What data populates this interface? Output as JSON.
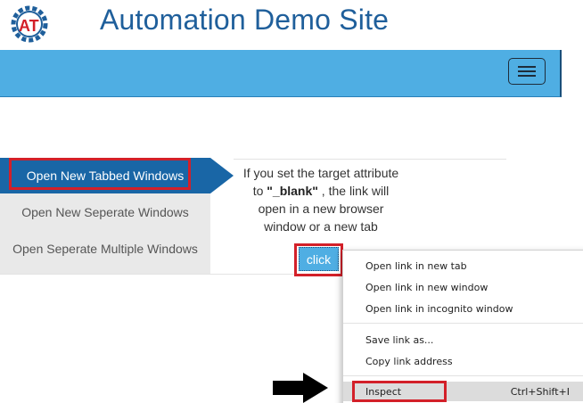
{
  "header": {
    "title": "Automation Demo Site",
    "logo_letters": "AT",
    "brand_color": "#1f5f9b"
  },
  "navbar": {
    "color": "#4faee3",
    "menu_icon": "hamburger-menu-icon"
  },
  "tabs": [
    {
      "label": "Open New Tabbed Windows",
      "active": true
    },
    {
      "label": "Open New Seperate Windows",
      "active": false
    },
    {
      "label": "Open Seperate Multiple Windows",
      "active": false
    }
  ],
  "description": {
    "line1": "If you set the target attribute",
    "line2_pre": "to ",
    "line2_bold": "\"_blank\"",
    "line2_post": " , the link will",
    "line3": "open in a new browser",
    "line4": "window or a new tab"
  },
  "click_button": {
    "label": "click"
  },
  "context_menu": {
    "items": [
      {
        "label": "Open link in new tab"
      },
      {
        "label": "Open link in new window"
      },
      {
        "label": "Open link in incognito window"
      },
      {
        "label": "Save link as..."
      },
      {
        "label": "Copy link address"
      },
      {
        "label": "Inspect",
        "shortcut": "Ctrl+Shift+I"
      }
    ]
  },
  "colors": {
    "highlight": "#d32029",
    "active_tab": "#1966a6"
  }
}
